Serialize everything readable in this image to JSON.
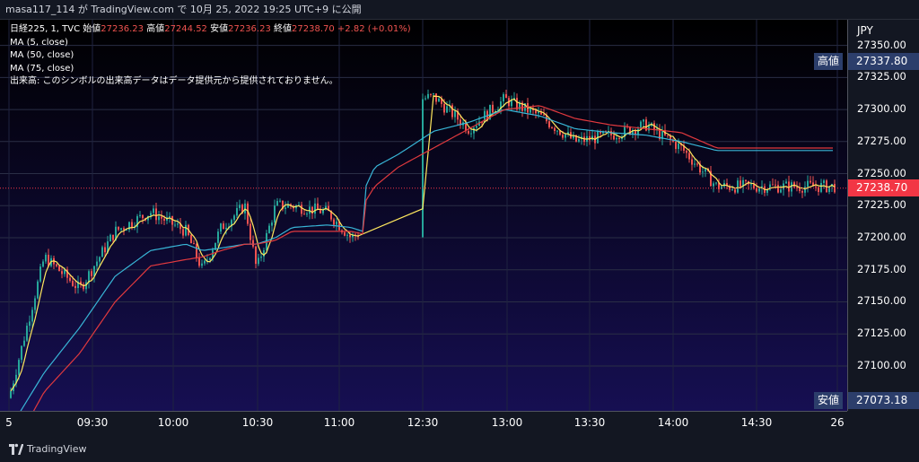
{
  "header": {
    "author": "masa117_114",
    "connector1": "が",
    "site": "TradingView.com",
    "connector2": "で",
    "datetime": "10月 25, 2022 19:25 UTC+9",
    "connector3": "に公開"
  },
  "legend": {
    "symbol": "日経225, 1, TVC",
    "open_label": "始値",
    "open": "27236.23",
    "high_label": "高値",
    "high": "27244.52",
    "low_label": "安値",
    "low": "27236.23",
    "close_label": "終値",
    "close": "27238.70",
    "change": "+2.82 (+0.01%)",
    "ma1": "MA (5, close)",
    "ma2": "MA (50, close)",
    "ma3": "MA (75, close)",
    "volume_note": "出来高: このシンボルの出来高データはデータ提供元から提供されておりません。"
  },
  "price_axis": {
    "currency": "JPY",
    "ticks": [
      "27350.00",
      "27325.00",
      "27300.00",
      "27275.00",
      "27250.00",
      "27225.00",
      "27200.00",
      "27175.00",
      "27150.00",
      "27125.00",
      "27100.00"
    ],
    "high_tag_label": "高値",
    "high_tag_value": "27337.80",
    "last_value": "27238.70",
    "low_tag_label": "安値",
    "low_tag_value": "27073.18"
  },
  "time_axis": {
    "ticks": [
      "5",
      "09:30",
      "10:00",
      "10:30",
      "11:00",
      "12:30",
      "13:00",
      "13:30",
      "14:00",
      "14:30",
      "26"
    ]
  },
  "footer": {
    "brand": "TradingView"
  },
  "colors": {
    "background": "#131722",
    "gradient_top": "#000000",
    "gradient_bottom": "#160f52",
    "up": "#26a69a",
    "down": "#ef5350",
    "ma5": "#ffe85e",
    "ma50": "#38b5d6",
    "ma75": "#e0393e",
    "last_price": "#f23645",
    "tag_bg": "#2c3e6b"
  },
  "chart_data": {
    "type": "line",
    "title": "日経225, 1, TVC",
    "x": [
      "09:00",
      "09:15",
      "09:30",
      "09:45",
      "10:00",
      "10:15",
      "10:22",
      "10:30",
      "10:40",
      "10:45",
      "10:53",
      "11:00",
      "11:15",
      "11:25",
      "11:30",
      "12:30",
      "12:35",
      "12:45",
      "13:00",
      "13:15",
      "13:30",
      "13:45",
      "14:00",
      "14:15",
      "14:30",
      "14:45",
      "15:00"
    ],
    "series": [
      {
        "name": "日経225 close",
        "values": [
          27075,
          27185,
          27160,
          27205,
          27220,
          27205,
          27175,
          27208,
          27225,
          27175,
          27225,
          27225,
          27220,
          27200,
          27205,
          27330,
          27320,
          27305,
          27310,
          27285,
          27308,
          27295,
          27275,
          27280,
          27288,
          27270,
          27240
        ]
      },
      {
        "name": "MA (50, close)",
        "values": [
          27050,
          27095,
          27130,
          27170,
          27190,
          27195,
          27190,
          27192,
          27195,
          27195,
          27200,
          27208,
          27210,
          27208,
          27205,
          27235,
          27255,
          27265,
          27283,
          27290,
          27300,
          27295,
          27285,
          27282,
          27280,
          27275,
          27268
        ]
      },
      {
        "name": "MA (75, close)",
        "values": [
          27030,
          27080,
          27110,
          27150,
          27178,
          27183,
          27185,
          27190,
          27195,
          27195,
          27198,
          27205,
          27205,
          27205,
          27203,
          27225,
          27240,
          27255,
          27270,
          27285,
          27300,
          27303,
          27293,
          27288,
          27285,
          27282,
          27270
        ]
      }
    ],
    "xlabel": "",
    "ylabel": "",
    "ylim": [
      27065,
      27370
    ],
    "grid": true
  }
}
